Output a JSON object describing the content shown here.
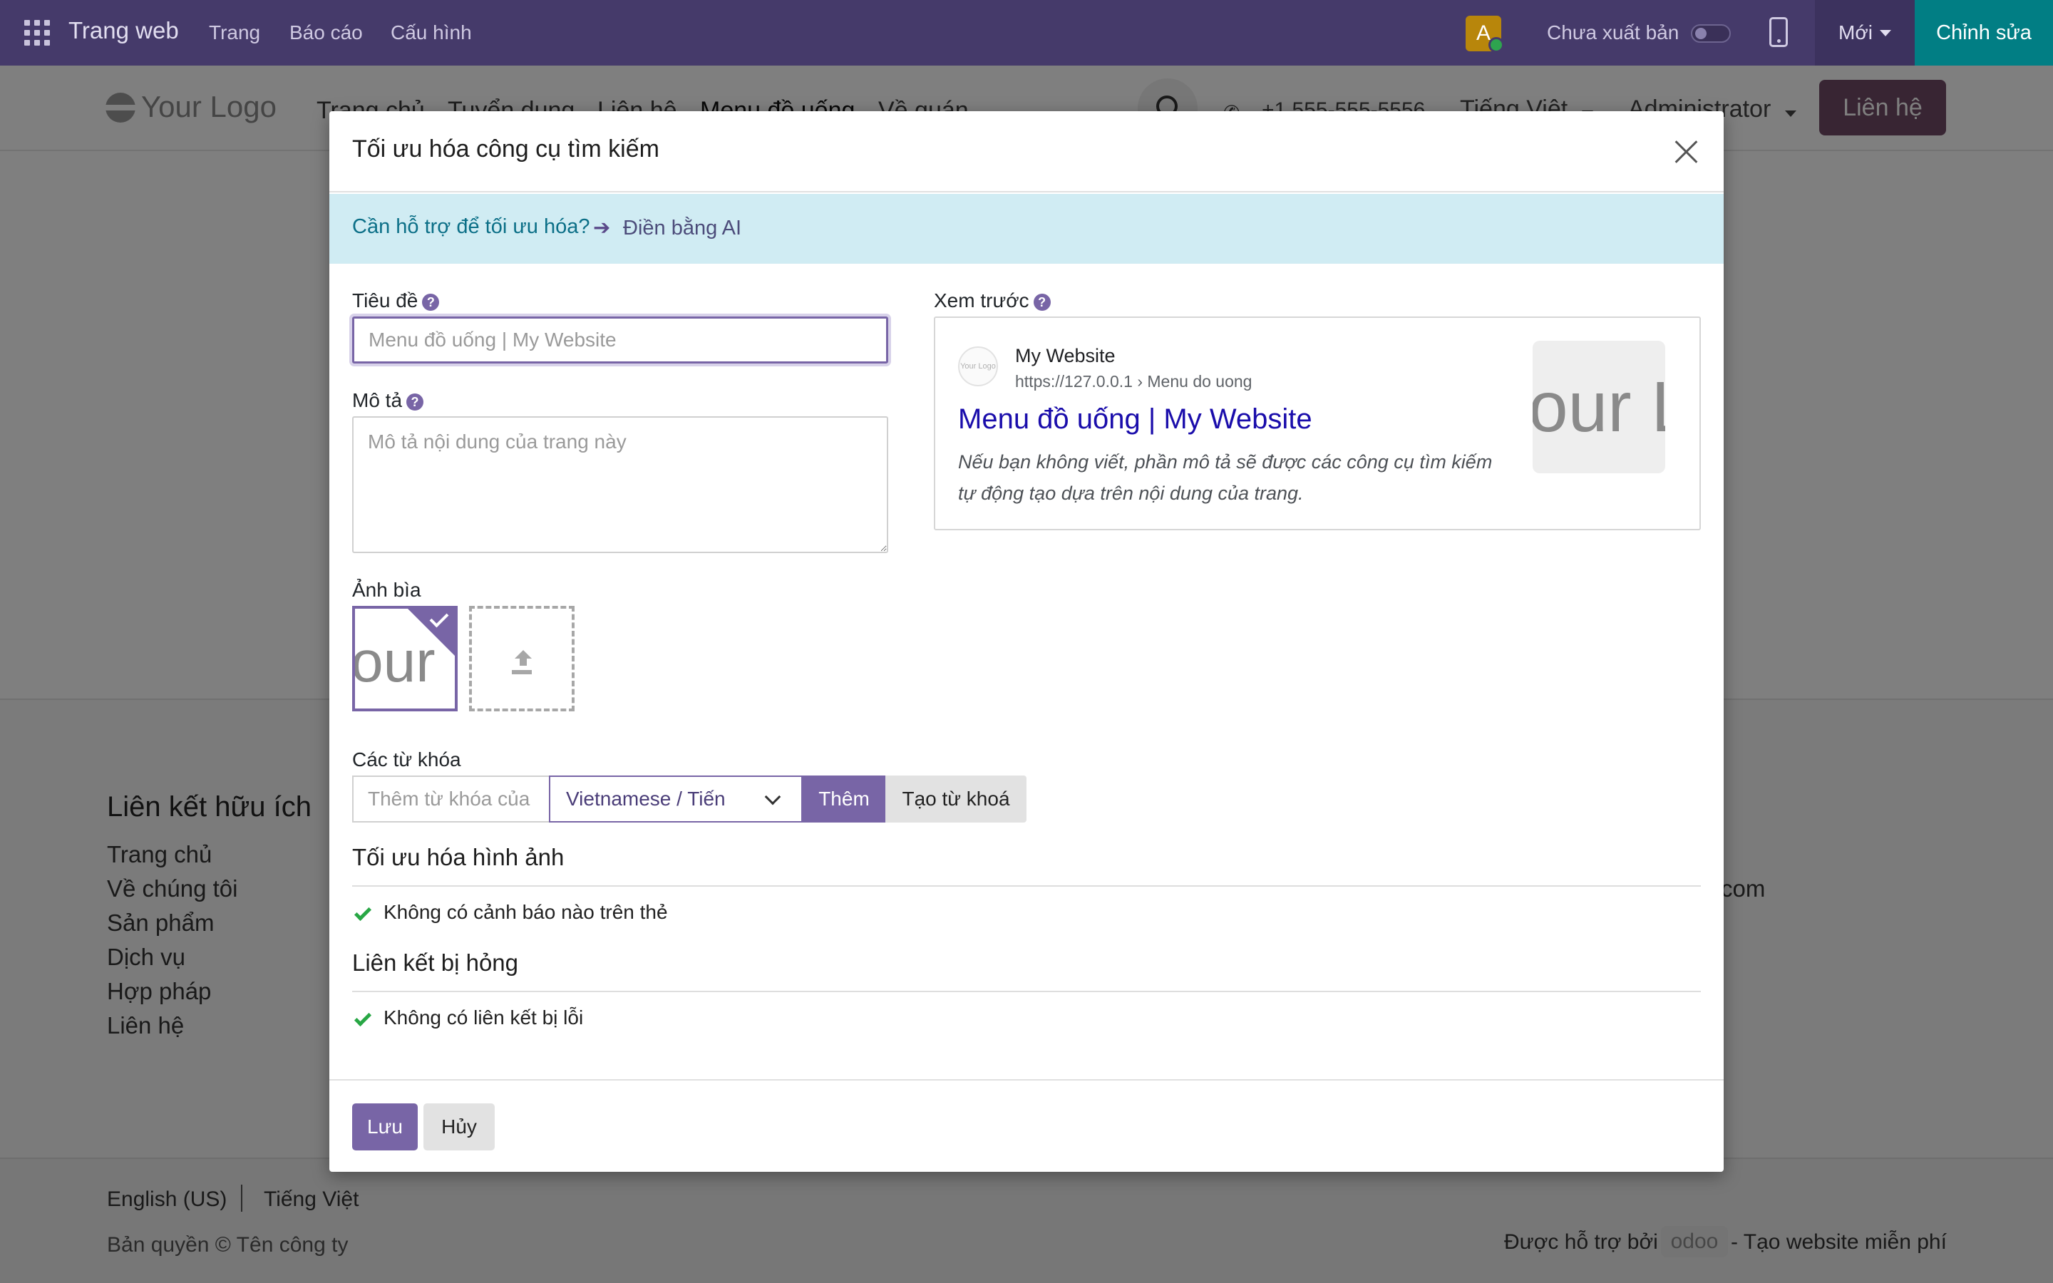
{
  "topbar": {
    "brand": "Trang web",
    "menu": [
      "Trang",
      "Báo cáo",
      "Cấu hình"
    ],
    "avatar_letter": "A",
    "unpublished_label": "Chưa xuất bản",
    "new_label": "Mới",
    "edit_label": "Chỉnh sửa"
  },
  "site": {
    "logo_text": "Your Logo",
    "nav": [
      "Trang chủ",
      "Tuyển dụng",
      "Liên hệ",
      "Menu đồ uống",
      "Về quán"
    ],
    "phone": "+1 555-555-5556",
    "language": "Tiếng Việt",
    "user": "Administrator",
    "contact_label": "Liên hệ"
  },
  "footer": {
    "heading": "Liên kết hữu ích",
    "links": [
      "Trang chủ",
      "Về chúng tôi",
      "Sản phẩm",
      "Dịch vụ",
      "Hợp pháp",
      "Liên hệ"
    ],
    "mail_fragment": "com",
    "lang_en": "English (US)",
    "lang_vi": "Tiếng Việt",
    "copyright": "Bản quyền © Tên công ty",
    "powered": "Được hỗ trợ bởi",
    "odoo": "odoo",
    "create": "- Tạo website miễn phí"
  },
  "modal": {
    "title": "Tối ưu hóa công cụ tìm kiếm",
    "ai_question": "Cần hỗ trợ để tối ưu hóa?",
    "ai_link": "Điền bằng AI",
    "title_label": "Tiêu đề",
    "title_placeholder": "Menu đồ uống | My Website",
    "desc_label": "Mô tả",
    "desc_placeholder": "Mô tả nội dung của trang này",
    "preview_label": "Xem trước",
    "preview": {
      "favicon_text": "Your Logo",
      "site_name": "My Website",
      "url": "https://127.0.0.1 › Menu do uong",
      "page_title": "Menu đồ uống | My Website",
      "description": "Nếu bạn không viết, phần mô tả sẽ được các công cụ tìm kiếm tự động tạo dựa trên nội dung của trang.",
      "thumb_text": "our L"
    },
    "cover_label": "Ảnh bìa",
    "cover_text": "our L",
    "keywords_label": "Các từ khóa",
    "keywords_placeholder": "Thêm từ khóa của",
    "keywords_language": "Vietnamese / Tiến",
    "add_label": "Thêm",
    "generate_label": "Tạo từ khoá",
    "image_section": "Tối ưu hóa hình ảnh",
    "image_ok": "Không có cảnh báo nào trên thẻ",
    "links_section": "Liên kết bị hỏng",
    "links_ok": "Không có liên kết bị lỗi",
    "save_label": "Lưu",
    "cancel_label": "Hủy",
    "help_glyph": "?"
  },
  "colors": {
    "topbar": "#453a6a",
    "accent": "#7865a6",
    "edit": "#017e84",
    "contact": "#714b67",
    "banner": "#d0ecf3",
    "ok": "#28a745"
  }
}
